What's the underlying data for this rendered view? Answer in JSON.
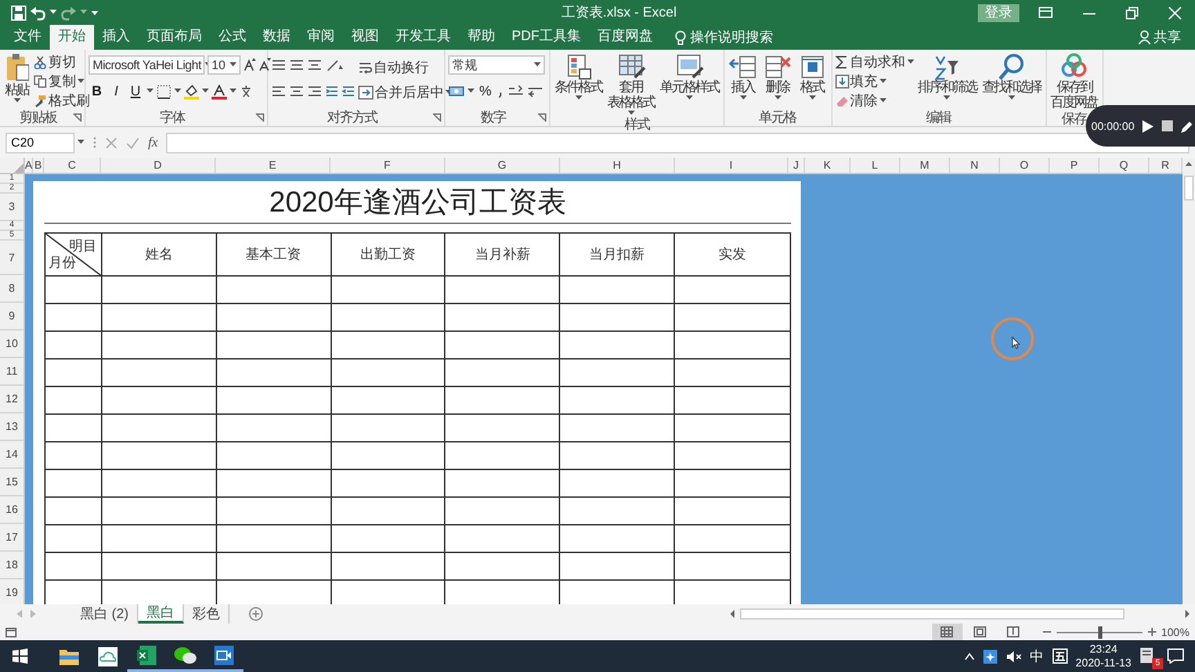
{
  "window": {
    "title": "工资表.xlsx - Excel",
    "login_button": "登录",
    "share_button": "共享"
  },
  "ribbon_tabs": [
    {
      "label": "文件",
      "selected": false
    },
    {
      "label": "开始",
      "selected": true
    },
    {
      "label": "插入",
      "selected": false
    },
    {
      "label": "页面布局",
      "selected": false
    },
    {
      "label": "公式",
      "selected": false
    },
    {
      "label": "数据",
      "selected": false
    },
    {
      "label": "审阅",
      "selected": false
    },
    {
      "label": "视图",
      "selected": false
    },
    {
      "label": "开发工具",
      "selected": false
    },
    {
      "label": "帮助",
      "selected": false
    },
    {
      "label": "PDF工具集",
      "selected": false
    },
    {
      "label": "百度网盘",
      "selected": false
    }
  ],
  "tell_me": {
    "placeholder": "操作说明搜索"
  },
  "ribbon_groups": [
    {
      "kind": "clipboard",
      "name": "剪贴板",
      "large": "粘贴",
      "small": [
        "剪切",
        "复制",
        "格式刷"
      ]
    },
    {
      "kind": "font",
      "name": "字体",
      "font": "Microsoft YaHei Light",
      "size": "10",
      "styles": [
        "B",
        "I",
        "U"
      ]
    },
    {
      "kind": "align",
      "name": "对齐方式",
      "small": [
        "自动换行",
        "合并后居中"
      ]
    },
    {
      "kind": "number",
      "name": "数字",
      "format": "常规",
      "percent": "%"
    },
    {
      "kind": "styles",
      "name": "样式",
      "buttons": [
        [
          "条件格式"
        ],
        [
          "套用",
          "表格格式"
        ],
        [
          "单元格样式"
        ]
      ]
    },
    {
      "kind": "cells",
      "name": "单元格",
      "buttons": [
        [
          "插入"
        ],
        [
          "删除"
        ],
        [
          "格式"
        ]
      ]
    },
    {
      "kind": "editing",
      "name": "编辑",
      "small": [
        "自动求和",
        "填充",
        "清除"
      ],
      "buttons": [
        [
          "排序和筛选"
        ],
        [
          "查找和选择"
        ]
      ]
    },
    {
      "kind": "save",
      "name": "保存",
      "buttons": [
        [
          "保存到",
          "百度网盘"
        ]
      ]
    }
  ],
  "formula_bar": {
    "name_box": "C20",
    "fx": "fx"
  },
  "columns": [
    "A",
    "B",
    "C",
    "D",
    "E",
    "F",
    "G",
    "H",
    "I",
    "J",
    "K",
    "L",
    "M",
    "N",
    "O",
    "P",
    "Q",
    "R"
  ],
  "rows": [
    "1",
    "2",
    "3",
    "4",
    "5",
    "7",
    "8",
    "9",
    "10",
    "11",
    "12",
    "13",
    "14",
    "15",
    "16",
    "17",
    "18",
    "19"
  ],
  "sheet": {
    "title": "2020年逢酒公司工资表",
    "corner_top": "明目",
    "corner_bottom": "月份",
    "headers": [
      "姓名",
      "基本工资",
      "出勤工资",
      "当月补薪",
      "当月扣薪",
      "实发"
    ]
  },
  "sheet_tabs": [
    {
      "label": "黑白 (2)",
      "selected": false
    },
    {
      "label": "黑白",
      "selected": true
    },
    {
      "label": "彩色",
      "selected": false
    }
  ],
  "status": {
    "views": [
      {
        "kind": "normal",
        "selected": true
      },
      {
        "kind": "page_layout",
        "selected": false
      },
      {
        "kind": "page_break",
        "selected": false
      }
    ],
    "zoom_slider": {
      "level": 0.5
    },
    "zoom": "100%"
  },
  "taskbar": {
    "apps": [
      {
        "kind": "explorer",
        "running": false
      },
      {
        "kind": "cloud",
        "running": false
      },
      {
        "kind": "excel",
        "running": true
      },
      {
        "kind": "wechat",
        "running": true
      },
      {
        "kind": "video",
        "running": true
      }
    ],
    "ime": "中",
    "time": "23:24",
    "date": "2020-11-13",
    "notification_count": "5"
  },
  "recorder": {
    "time": "00:00:00"
  }
}
